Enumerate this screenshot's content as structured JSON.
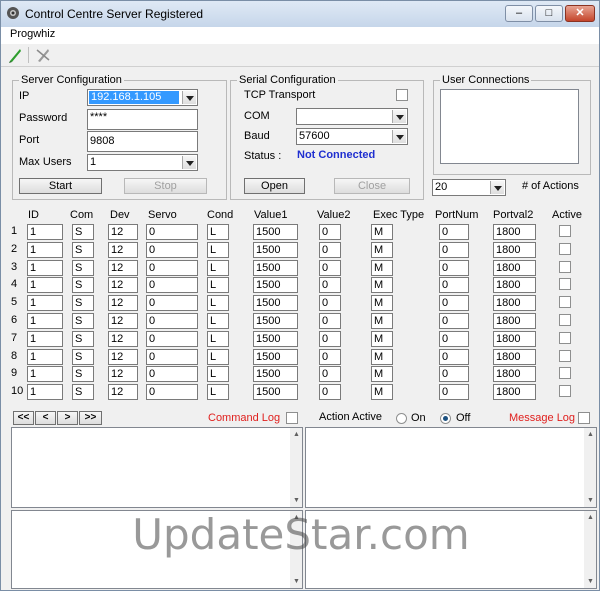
{
  "window": {
    "title": "Control Centre Server Registered"
  },
  "menu": {
    "items": [
      "Progwhiz"
    ]
  },
  "toolbar": {
    "icons": [
      "connect-icon",
      "disconnect-icon"
    ]
  },
  "server": {
    "legend": "Server Configuration",
    "ip_label": "IP",
    "ip_value": "192.168.1.105",
    "password_label": "Password",
    "password_value": "****",
    "port_label": "Port",
    "port_value": "9808",
    "max_users_label": "Max Users",
    "max_users_value": "1",
    "start_label": "Start",
    "stop_label": "Stop"
  },
  "serial": {
    "legend": "Serial Configuration",
    "tcp_label": "TCP Transport",
    "com_label": "COM",
    "com_value": "",
    "baud_label": "Baud",
    "baud_value": "57600",
    "status_label": "Status :",
    "status_value": "Not Connected",
    "status_color": "#1f2fd0",
    "open_label": "Open",
    "close_label": "Close"
  },
  "users": {
    "legend": "User Connections",
    "actions_value": "20",
    "actions_label": "# of Actions"
  },
  "table": {
    "headers": [
      "ID",
      "Com",
      "Dev",
      "Servo",
      "Cond",
      "Value1",
      "Value2",
      "Exec Type",
      "PortNum",
      "Portval2",
      "Active"
    ],
    "rows": [
      {
        "n": "1",
        "id": "1",
        "com": "S",
        "dev": "12",
        "servo": "0",
        "cond": "L",
        "v1": "1500",
        "v2": "0",
        "exec": "M",
        "port": "0",
        "pv2": "1800"
      },
      {
        "n": "2",
        "id": "1",
        "com": "S",
        "dev": "12",
        "servo": "0",
        "cond": "L",
        "v1": "1500",
        "v2": "0",
        "exec": "M",
        "port": "0",
        "pv2": "1800"
      },
      {
        "n": "3",
        "id": "1",
        "com": "S",
        "dev": "12",
        "servo": "0",
        "cond": "L",
        "v1": "1500",
        "v2": "0",
        "exec": "M",
        "port": "0",
        "pv2": "1800"
      },
      {
        "n": "4",
        "id": "1",
        "com": "S",
        "dev": "12",
        "servo": "0",
        "cond": "L",
        "v1": "1500",
        "v2": "0",
        "exec": "M",
        "port": "0",
        "pv2": "1800"
      },
      {
        "n": "5",
        "id": "1",
        "com": "S",
        "dev": "12",
        "servo": "0",
        "cond": "L",
        "v1": "1500",
        "v2": "0",
        "exec": "M",
        "port": "0",
        "pv2": "1800"
      },
      {
        "n": "6",
        "id": "1",
        "com": "S",
        "dev": "12",
        "servo": "0",
        "cond": "L",
        "v1": "1500",
        "v2": "0",
        "exec": "M",
        "port": "0",
        "pv2": "1800"
      },
      {
        "n": "7",
        "id": "1",
        "com": "S",
        "dev": "12",
        "servo": "0",
        "cond": "L",
        "v1": "1500",
        "v2": "0",
        "exec": "M",
        "port": "0",
        "pv2": "1800"
      },
      {
        "n": "8",
        "id": "1",
        "com": "S",
        "dev": "12",
        "servo": "0",
        "cond": "L",
        "v1": "1500",
        "v2": "0",
        "exec": "M",
        "port": "0",
        "pv2": "1800"
      },
      {
        "n": "9",
        "id": "1",
        "com": "S",
        "dev": "12",
        "servo": "0",
        "cond": "L",
        "v1": "1500",
        "v2": "0",
        "exec": "M",
        "port": "0",
        "pv2": "1800"
      },
      {
        "n": "10",
        "id": "1",
        "com": "S",
        "dev": "12",
        "servo": "0",
        "cond": "L",
        "v1": "1500",
        "v2": "0",
        "exec": "M",
        "port": "0",
        "pv2": "1800"
      }
    ]
  },
  "bottom": {
    "nav": [
      "<<",
      "<",
      ">",
      ">>"
    ],
    "command_log_label": "Command  Log",
    "action_active_label": "Action Active",
    "on_label": "On",
    "off_label": "Off",
    "message_log_label": "Message Log",
    "log_color": "#e0201e"
  },
  "watermark": "UpdateStar.com"
}
